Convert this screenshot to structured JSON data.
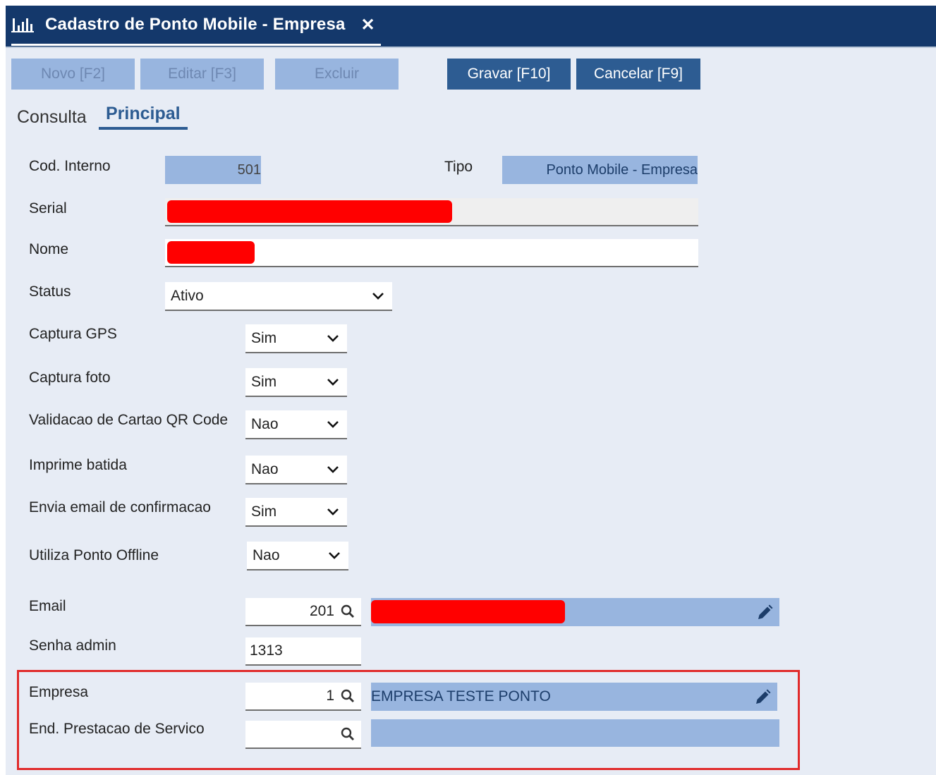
{
  "window": {
    "title": "Cadastro de Ponto Mobile - Empresa",
    "close_label": "✕",
    "icon": "bar-chart-icon"
  },
  "toolbar": {
    "novo": "Novo [F2]",
    "editar": "Editar [F3]",
    "excluir": "Excluir",
    "gravar": "Gravar [F10]",
    "cancelar": "Cancelar [F9]"
  },
  "tabs": {
    "consulta": "Consulta",
    "principal": "Principal"
  },
  "form": {
    "cod_interno_label": "Cod. Interno",
    "cod_interno_value": "501",
    "tipo_label": "Tipo",
    "tipo_value": "Ponto Mobile - Empresa",
    "serial_label": "Serial",
    "nome_label": "Nome",
    "status_label": "Status",
    "status_value": "Ativo",
    "captura_gps_label": "Captura GPS",
    "captura_gps_value": "Sim",
    "captura_foto_label": "Captura foto",
    "captura_foto_value": "Sim",
    "validacao_qr_label": "Validacao de Cartao QR Code",
    "validacao_qr_value": "Nao",
    "imprime_batida_label": "Imprime batida",
    "imprime_batida_value": "Nao",
    "envia_email_label": "Envia email de confirmacao",
    "envia_email_value": "Sim",
    "ponto_offline_label": "Utiliza Ponto Offline",
    "ponto_offline_value": "Nao",
    "email_label": "Email",
    "email_code": "201",
    "senha_label": "Senha admin",
    "senha_value": "1313",
    "empresa_label": "Empresa",
    "empresa_code": "1",
    "empresa_desc": "EMPRESA TESTE PONTO",
    "end_prestacao_label": "End. Prestacao de Servico",
    "end_prestacao_code": "",
    "end_prestacao_desc": ""
  },
  "colors": {
    "titlebar": "#14386b",
    "accent": "#2d5c92",
    "readonly_field": "#98b5df",
    "background": "#e7ecf5",
    "highlight_border": "#e12a2a",
    "redaction": "#ff0000"
  }
}
